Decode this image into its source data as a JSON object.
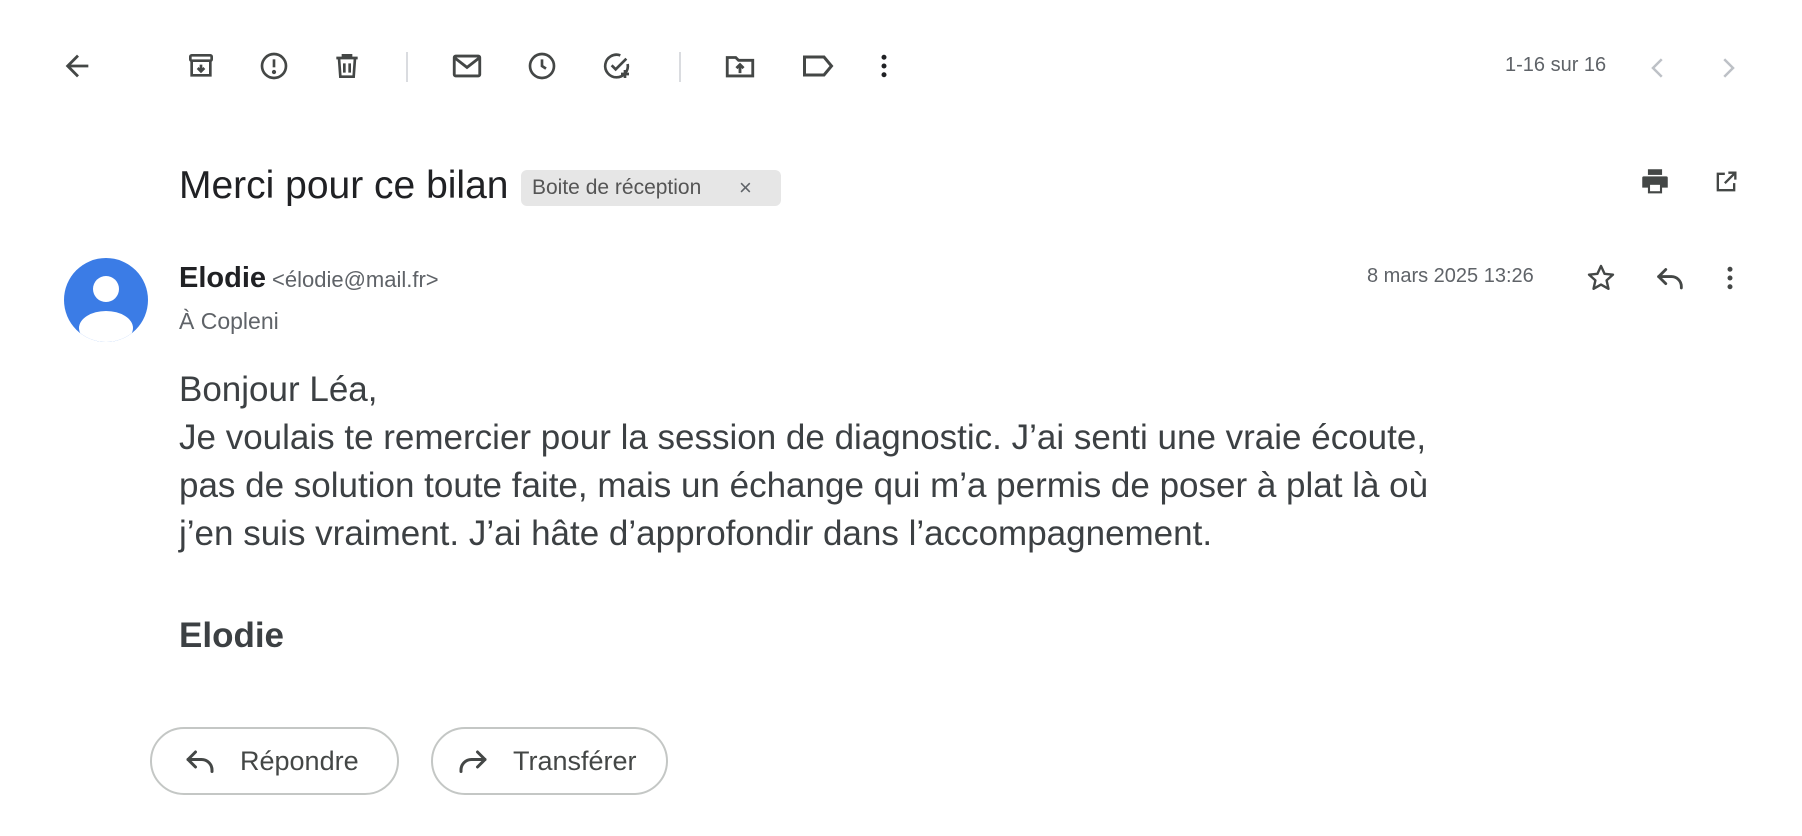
{
  "toolbar": {
    "back": "back-arrow-icon",
    "archive": "archive-icon",
    "report_spam": "report-spam-icon",
    "delete": "trash-icon",
    "mark_unread": "mail-icon",
    "snooze": "clock-icon",
    "add_task": "add-task-icon",
    "move_to": "move-to-folder-icon",
    "labels": "label-icon",
    "more": "more-vertical-icon",
    "page_counter": "1-16 sur 16",
    "prev": "chevron-left-icon",
    "next": "chevron-right-icon"
  },
  "message": {
    "subject": "Merci pour ce bilan",
    "label": "Boite de réception",
    "label_remove": "×",
    "sender_name": "Elodie",
    "sender_email": "<élodie@mail.fr>",
    "recipient": "À Copleni",
    "timestamp": "8 mars 2025 13:26",
    "body_lines": [
      "Bonjour Léa,",
      "Je voulais te remercier pour la session de diagnostic. J’ai senti une vraie écoute,",
      "pas de solution toute faite, mais un échange qui m’a permis de poser à plat là où",
      "j’en suis vraiment. J’ai hâte d’approfondir dans l’accompagnement."
    ],
    "signature": "Elodie"
  },
  "actions": {
    "reply_label": "Répondre",
    "forward_label": "Transférer"
  },
  "colors": {
    "avatar": "#3b7ce6",
    "icon": "#444746",
    "chip_bg": "#e6e6e6"
  }
}
